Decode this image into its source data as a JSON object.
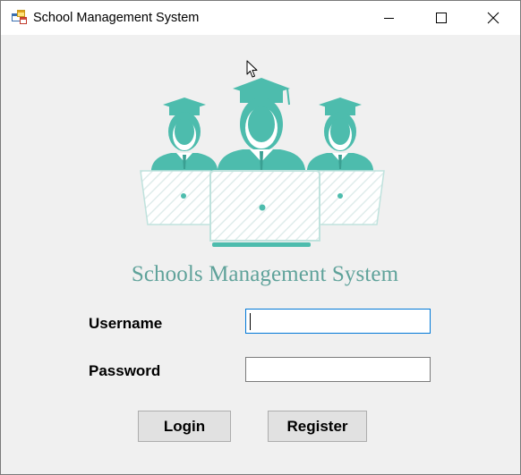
{
  "window": {
    "title": "School Management System",
    "controls": {
      "minimize_icon": "minimize-icon",
      "maximize_icon": "maximize-icon",
      "close_icon": "close-icon"
    }
  },
  "logo": {
    "icon": "graduates-with-laptops-logo",
    "color": "#4dbcad"
  },
  "brand_title": "Schools Management System",
  "form": {
    "username_label": "Username",
    "username_value": "",
    "password_label": "Password",
    "password_value": ""
  },
  "buttons": {
    "login_label": "Login",
    "register_label": "Register"
  },
  "colors": {
    "window_bg": "#f0f0f0",
    "titlebar_bg": "#ffffff",
    "brand_text": "#5fa29a",
    "logo_teal": "#4dbcad",
    "focus_border": "#0078d7",
    "button_bg": "#e1e1e1"
  }
}
